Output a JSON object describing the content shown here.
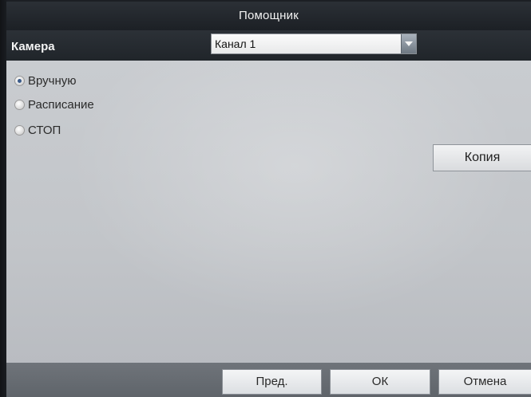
{
  "dialog": {
    "title": "Помощник"
  },
  "camera": {
    "label": "Камера",
    "selected_channel": "Канал 1"
  },
  "schedule_mode": {
    "options": [
      {
        "label": "Вручную",
        "selected": true
      },
      {
        "label": "Расписание",
        "selected": false
      },
      {
        "label": "СТОП",
        "selected": false
      }
    ]
  },
  "actions": {
    "copy_label": "Копия"
  },
  "footer": {
    "prev_label": "Пред.",
    "ok_label": "ОК",
    "cancel_label": "Отмена"
  }
}
